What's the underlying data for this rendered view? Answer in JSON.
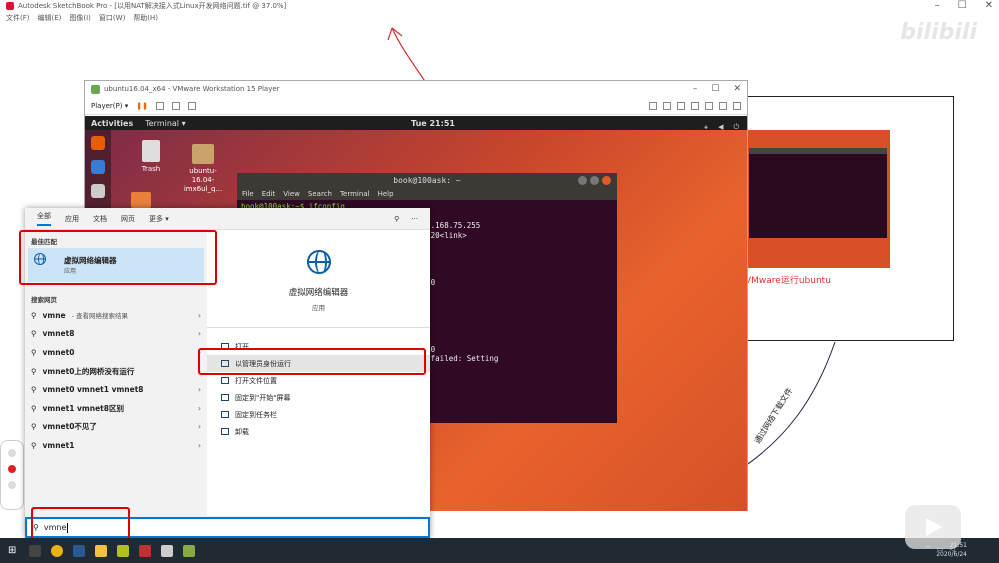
{
  "sketchbook": {
    "title": "Autodesk SketchBook Pro - [以用NAT解决接入式Linux开发网络问题.tif @ 37.0%]",
    "menu": [
      "文件(F)",
      "编辑(E)",
      "图像(I)",
      "窗口(W)",
      "帮助(H)"
    ],
    "watermark": "bilibili",
    "side_caption": "VMware运行ubuntu",
    "rotated_note": "通过网络下载文件"
  },
  "vmware": {
    "title": "ubuntu16.04_x64 - VMware Workstation 15 Player",
    "player_menu": "Player(P) ▾",
    "window_controls": [
      "–",
      "☐",
      "✕"
    ]
  },
  "ubuntu": {
    "activities": "Activities",
    "app_menu": "Terminal ▾",
    "clock": "Tue 21:51",
    "desktop_icons": [
      {
        "label": "Trash"
      },
      {
        "label": "ubuntu-16.04-imx6ul_q..."
      }
    ]
  },
  "terminal": {
    "title": "book@100ask: ~",
    "menu": [
      "File",
      "Edit",
      "View",
      "Search",
      "Terminal",
      "Help"
    ],
    "lines": [
      "book@100ask:~$ ifconfig",
      "                  LTICAST>  mtu 1500",
      "                  255.255.0  broadcast 192.168.75.255",
      "                  prefixlen 64  scopeid 0x20<link>",
      "                  len 1000  (Ethernet)",
      "                  .7 KB)",
      "                  0  frame 0",
      "                  KB)",
      "                    carrier 0  collisions 0",
      "",
      "                  536",
      "",
      "                  0x10<host>",
      "                  pback)",
      "                  2 KB)",
      "                  0  frame 0",
      "                  KB)",
      "                    carrier 0  collisions 0",
      "",
      "",
      "",
      "                  : Set document metadata failed: Setting",
      "                  not supported"
    ]
  },
  "start_menu": {
    "tabs": [
      "全部",
      "应用",
      "文档",
      "网页",
      "更多 ▾"
    ],
    "best_match_header": "最佳匹配",
    "best_match": {
      "title": "虚拟网络编辑器",
      "type": "应用"
    },
    "web_header": "搜索网页",
    "results": [
      {
        "text": "vmne",
        "sub": " - 查看网络搜索结果"
      },
      {
        "text": "vmnet8",
        "sub": ""
      },
      {
        "text": "vmnet0",
        "sub": ""
      },
      {
        "text": "vmnet0上的网桥没有运行",
        "sub": ""
      },
      {
        "text": "vmnet0 vmnet1 vmnet8",
        "sub": ""
      },
      {
        "text": "vmnet1 vmnet8区别",
        "sub": ""
      },
      {
        "text": "vmnet0不见了",
        "sub": ""
      },
      {
        "text": "vmnet1",
        "sub": ""
      }
    ],
    "app_name": "虚拟网络编辑器",
    "app_type": "应用",
    "actions": [
      "打开",
      "以管理员身份运行",
      "打开文件位置",
      "固定到\"开始\"屏幕",
      "固定到任务栏",
      "卸载"
    ],
    "search_value": "vmne"
  },
  "taskbar": {
    "date": "2020/6/24",
    "time": "21:51"
  }
}
